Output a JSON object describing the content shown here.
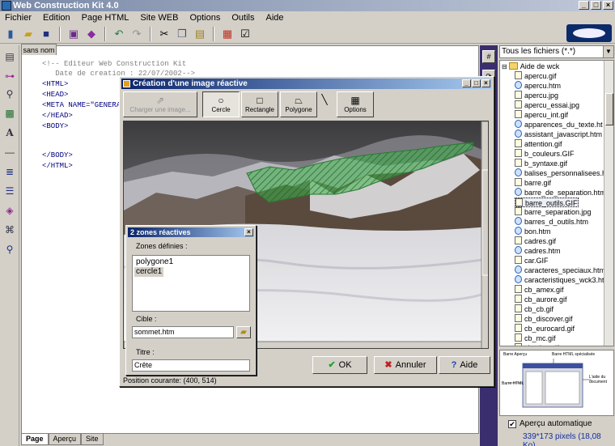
{
  "window": {
    "title": "Web Construction Kit 4.0"
  },
  "menu": [
    "Fichier",
    "Edition",
    "Page HTML",
    "Site WEB",
    "Options",
    "Outils",
    "Aide"
  ],
  "toolbar": {
    "icons": [
      "new-file-icon",
      "open-folder-icon",
      "save-icon",
      "print-icon",
      "preview-icon",
      "undo-icon",
      "redo-icon",
      "cut-icon",
      "copy-icon",
      "paste-icon",
      "table-icon",
      "check-icon"
    ]
  },
  "editor": {
    "tab": "sans nom",
    "lines": [
      "<!-- Editeur Web Construction Kit",
      "   Date de creation : 22/07/2002-->",
      "<HTML>",
      "<HEAD>",
      "<META NAME=\"GENERA",
      "</HEAD>",
      "<BODY>",
      "",
      "",
      "</BODY>",
      "</HTML>"
    ],
    "bottom_tabs": [
      "Page",
      "Aperçu",
      "Site"
    ]
  },
  "file_panel": {
    "filter": "Tous les fichiers (*.*)",
    "root": "Aide de wck",
    "files": [
      {
        "name": "apercu.gif",
        "type": "img"
      },
      {
        "name": "apercu.htm",
        "type": "htm"
      },
      {
        "name": "apercu.jpg",
        "type": "img"
      },
      {
        "name": "apercu_essai.jpg",
        "type": "img"
      },
      {
        "name": "apercu_int.gif",
        "type": "img"
      },
      {
        "name": "apparences_du_texte.ht",
        "type": "htm"
      },
      {
        "name": "assistant_javascript.htm",
        "type": "htm"
      },
      {
        "name": "attention.gif",
        "type": "img"
      },
      {
        "name": "b_couleurs.GIF",
        "type": "img"
      },
      {
        "name": "b_syntaxe.gif",
        "type": "img"
      },
      {
        "name": "balises_personnalisees.h",
        "type": "htm"
      },
      {
        "name": "barre.gif",
        "type": "img"
      },
      {
        "name": "barre_de_separation.htm",
        "type": "htm"
      },
      {
        "name": "barre_outils.GIF",
        "type": "img"
      },
      {
        "name": "barre_separation.jpg",
        "type": "img"
      },
      {
        "name": "barres_d_outils.htm",
        "type": "htm"
      },
      {
        "name": "bon.htm",
        "type": "htm"
      },
      {
        "name": "cadres.gif",
        "type": "img"
      },
      {
        "name": "cadres.htm",
        "type": "htm"
      },
      {
        "name": "car.GIF",
        "type": "img"
      },
      {
        "name": "caracteres_speciaux.htm",
        "type": "htm"
      },
      {
        "name": "caracteristiques_wck3.ht",
        "type": "htm"
      },
      {
        "name": "cb_amex.gif",
        "type": "img"
      },
      {
        "name": "cb_aurore.gif",
        "type": "img"
      },
      {
        "name": "cb_cb.gif",
        "type": "img"
      },
      {
        "name": "cb_discover.gif",
        "type": "img"
      },
      {
        "name": "cb_eurocard.gif",
        "type": "img"
      },
      {
        "name": "cb_mc.gif",
        "type": "img"
      },
      {
        "name": "cb_visa.gif",
        "type": "img"
      }
    ],
    "selected_file": "barre_outils.GIF",
    "preview_labels": [
      "Barre HTML spécialisée",
      "Barre Aperçu",
      "Barre HTML",
      "L'aide du document"
    ],
    "auto_preview_label": "Aperçu automatique",
    "auto_preview_checked": true,
    "pixel_info": "339*173 pixels (18,08 Ko)"
  },
  "dialog": {
    "title": "Création d'une image réactive",
    "tools": [
      {
        "label": "Charger une image...",
        "icon": "load-image-icon"
      },
      {
        "label": "Cercle",
        "icon": "circle-icon"
      },
      {
        "label": "Rectangle",
        "icon": "rectangle-icon"
      },
      {
        "label": "Polygone",
        "icon": "polygon-icon"
      },
      {
        "label": "Options",
        "icon": "options-icon"
      }
    ],
    "status": "Position courante: (400, 514)",
    "buttons": {
      "ok": "OK",
      "cancel": "Annuler",
      "help": "Aide"
    }
  },
  "zones_panel": {
    "title": "2 zones réactives",
    "defined_label": "Zones définies :",
    "items": [
      "polygone1",
      "cercle1"
    ],
    "selected_item": "cercle1",
    "target_label": "Cible :",
    "target_value": "sommet.htm",
    "title_label": "Titre :",
    "title_value": "Crête"
  },
  "colors": {
    "left_strip": "#3a2e6e",
    "dialog_title": "#0a246a",
    "zone_fill": "#3db04a"
  }
}
